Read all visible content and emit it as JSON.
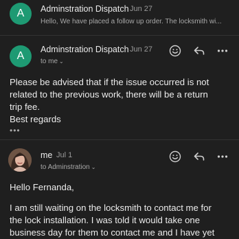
{
  "messages": [
    {
      "avatar_letter": "A",
      "sender": "Adminstration Dispatch",
      "date": "Jun 27",
      "snippet": "Hello, We have placed a follow up order. The locksmith wi..."
    },
    {
      "avatar_letter": "A",
      "sender": "Adminstration Dispatch",
      "date": "Jun 27",
      "recipient": "to me",
      "body_lines": [
        "Please be advised that if the issue occurred is not",
        "related to the previous work, there will be a return",
        "trip fee.",
        "Best regards"
      ],
      "trimmed_indicator": "•••"
    },
    {
      "sender": "me",
      "date": "Jul 1",
      "recipient": "to Adminstration",
      "greeting": "Hello Fernanda,",
      "body_lines": [
        "I am still waiting on the locksmith to contact me for",
        "the lock installation. I was told it would take one",
        "business day for them to contact me and I have yet"
      ]
    }
  ],
  "icons": {
    "emoji": "emoji-react-icon",
    "reply": "reply-icon",
    "more": "more-options-icon",
    "caret": "chevron-down-icon"
  },
  "colors": {
    "background": "#1f1f1f",
    "avatar": "#1e9a73",
    "divider": "#333333"
  }
}
